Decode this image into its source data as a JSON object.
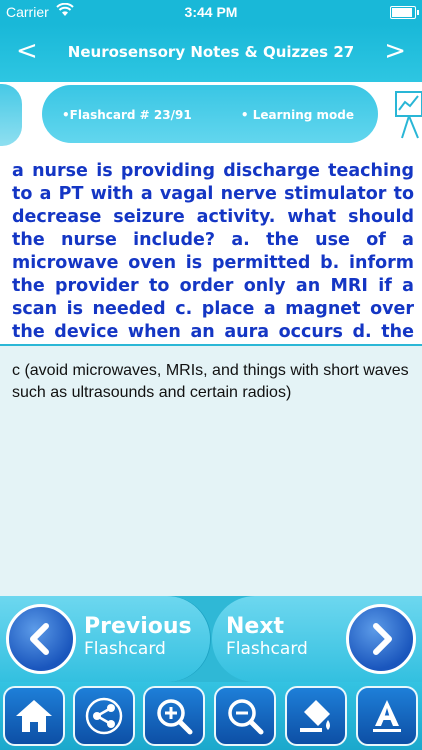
{
  "status": {
    "carrier": "Carrier",
    "time": "3:44 PM"
  },
  "nav": {
    "title": "Neurosensory Notes & Quizzes 27",
    "back": "<",
    "forward": ">"
  },
  "info": {
    "flashcard": "•Flashcard #  23/91",
    "mode": "• Learning mode"
  },
  "question": "a nurse is providing discharge teaching to a PT with a vagal nerve stimulator to decrease seizure activity. what should the nurse include? a. the use of a microwave oven is permitted b. inform the provider to order only an MRI if a scan is needed c. place a magnet over the device when an aura occurs d. the use of ultrasound",
  "answer": "c (avoid microwaves, MRIs, and things with short waves such as ultrasounds and certain radios)",
  "buttons": {
    "previous_big": "Previous",
    "previous_small": "Flashcard",
    "next_big": "Next",
    "next_small": "Flashcard"
  },
  "toolbar": [
    "home-icon",
    "share-icon",
    "zoom-in-icon",
    "zoom-out-icon",
    "paint-bucket-icon",
    "font-icon"
  ],
  "colors": {
    "accent": "#19b8d8",
    "question_text": "#1436c4",
    "button_blue": "#1a56bd"
  }
}
